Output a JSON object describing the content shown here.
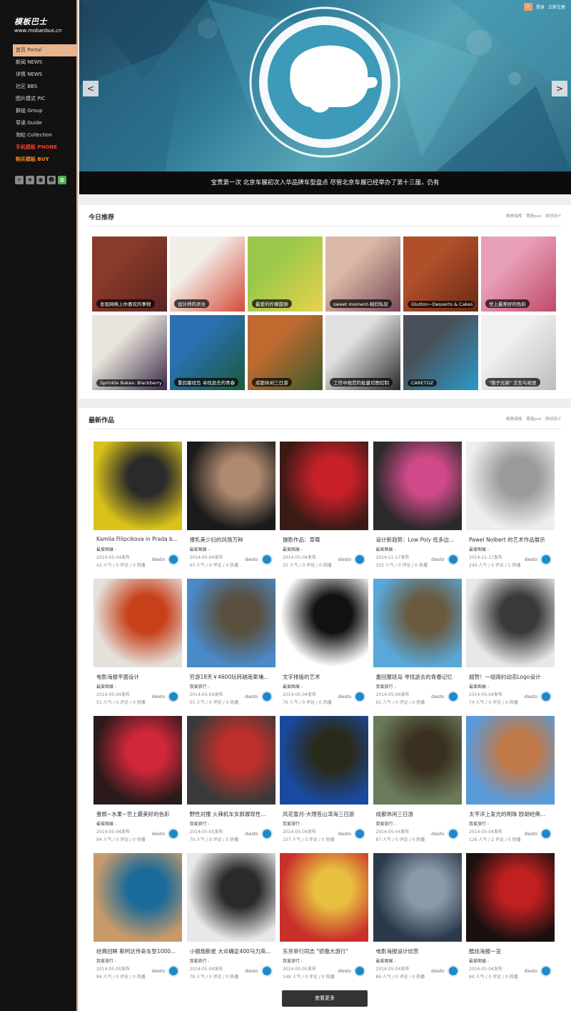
{
  "sidebar": {
    "logo_main": "模板巴士",
    "logo_sub": "www.mobanbus.cn",
    "nav": [
      {
        "label": "首页 Portal",
        "active": true
      },
      {
        "label": "新闻 NEWS"
      },
      {
        "label": "详情 NEWS"
      },
      {
        "label": "社区 BBS"
      },
      {
        "label": "图片模式 PIC"
      },
      {
        "label": "群组 Group"
      },
      {
        "label": "导读 Guide"
      },
      {
        "label": "淘帖 Collection"
      },
      {
        "label": "手机模板 PHONE",
        "style": "red"
      },
      {
        "label": "购买模板 BUY",
        "style": "orange"
      }
    ],
    "social_icons": [
      "plus-icon",
      "star-icon",
      "weibo-icon",
      "qq-icon",
      "wechat-icon"
    ]
  },
  "header": {
    "login": "登录",
    "register": "立即注册"
  },
  "banner": {
    "caption": "宝贵第一次 北京车展初次入华品牌车型盘点 尽管北京车展已经举办了第十三届，仍有",
    "prev": "<",
    "next": ">"
  },
  "recommend": {
    "title": "今日推荐",
    "links": [
      "精美海报",
      "筒造psd",
      "原创设计"
    ],
    "tiles": [
      {
        "label": "发现网络上你喜欢的事物",
        "colors": [
          "#8a3a2a",
          "#5a2420"
        ]
      },
      {
        "label": "设计师的灵光",
        "colors": [
          "#f2efe8",
          "#d54a3a"
        ]
      },
      {
        "label": "最爱的柠檬甜饼",
        "colors": [
          "#9bc84a",
          "#e8d24a"
        ]
      },
      {
        "label": "sweet moment-婉欣私房",
        "colors": [
          "#d9b9a6",
          "#7a4a5a"
        ]
      },
      {
        "label": "Glutton~Desserts & Cakes",
        "colors": [
          "#b0502a",
          "#6a2a16"
        ]
      },
      {
        "label": "世上最美好的色彩",
        "colors": [
          "#e8a0b8",
          "#c04a6a"
        ]
      },
      {
        "label": "Sprinkle Bakes: Blackberry",
        "colors": [
          "#e9e4dc",
          "#3a2a4a"
        ]
      },
      {
        "label": "重回塞班岛 寻找逝去的青春",
        "colors": [
          "#2a70b0",
          "#1a5a3a"
        ]
      },
      {
        "label": "成都休闲三日游",
        "colors": [
          "#c06a30",
          "#3a5a2a"
        ]
      },
      {
        "label": "工作中规范的批量切图控制",
        "colors": [
          "#e0e0e0",
          "#2a2a2a"
        ]
      },
      {
        "label": "CARETOZ",
        "colors": [
          "#4a505a",
          "#2a9ac8"
        ]
      },
      {
        "label": "\"筷子兄弟\" 交互与视觉",
        "colors": [
          "#f0f0f0",
          "#bcbcbc"
        ]
      }
    ]
  },
  "latest": {
    "title": "最新作品",
    "links": [
      "精美海报",
      "筒造psd",
      "原创设计"
    ],
    "cards": [
      {
        "title": "Kamila Filipcikova in Prada b...",
        "category": "最爱图展 -",
        "date": "2014-05-04发布",
        "stats": "42 人气 / 0 评论 / 0 热播",
        "author": "diesto",
        "colors": [
          "#d8c21a",
          "#2a2a2a"
        ]
      },
      {
        "title": "爆乳美少妇的风情万种",
        "category": "最爱图展 -",
        "date": "2014-05-04发布",
        "stats": "45 人气 / 0 评论 / 0 热播",
        "author": "diesto",
        "colors": [
          "#1a1a1a",
          "#b08a70"
        ]
      },
      {
        "title": "摄影作品：草莓",
        "category": "最爱图展 -",
        "date": "2014-05-04发布",
        "stats": "35 人气 / 0 评论 / 0 热播",
        "author": "diesto",
        "colors": [
          "#3a1a14",
          "#c8202a"
        ]
      },
      {
        "title": "设计新趋势：Low Poly 低多边...",
        "category": "最爱图展 -",
        "date": "2014-11-17发布",
        "stats": "323 人气 / 0 评论 / 0 热播",
        "author": "diesto",
        "colors": [
          "#2a2a2a",
          "#d04a8a"
        ]
      },
      {
        "title": "Pawel Nolbert 的艺术作品展示",
        "category": "最爱图展 -",
        "date": "2014-11-17发布",
        "stats": "244 人气 / 0 评论 / 1 热播",
        "author": "diesto",
        "colors": [
          "#eeeeee",
          "#9a9a9a"
        ]
      },
      {
        "title": "电影海报平面设计",
        "category": "最爱图展 -",
        "date": "2014-05-04发布",
        "stats": "51 人气 / 0 评论 / 0 热播",
        "author": "diesto",
        "colors": [
          "#e4e0da",
          "#c8401a"
        ]
      },
      {
        "title": "穷游18天￥4600玩转越南柬埔...",
        "category": "我爱旅行 -",
        "date": "2014-05-04发布",
        "stats": "55 人气 / 0 评论 / 0 热播",
        "author": "diesto",
        "colors": [
          "#4a8ac8",
          "#5a5040"
        ]
      },
      {
        "title": "文字排版的艺术",
        "category": "最爱图展 -",
        "date": "2014-05-04发布",
        "stats": "76 人气 / 0 评论 / 0 热播",
        "author": "diesto",
        "colors": [
          "#ffffff",
          "#111111"
        ]
      },
      {
        "title": "重回塞班岛 寻找逝去的青春记忆",
        "category": "我爱旅行 -",
        "date": "2014-05-04发布",
        "stats": "91 人气 / 0 评论 / 0 热播",
        "author": "diesto",
        "colors": [
          "#5aa8d8",
          "#6a5a40"
        ]
      },
      {
        "title": "超赞！一组简约动态Logo设计",
        "category": "最爱图展 -",
        "date": "2014-05-04发布",
        "stats": "74 人气 / 0 评论 / 0 热播",
        "author": "diesto",
        "colors": [
          "#e8e8e8",
          "#3a3a3a"
        ]
      },
      {
        "title": "蛋糕~水果~世上最美好的色彩",
        "category": "最爱图展 -",
        "date": "2014-05-04发布",
        "stats": "84 人气 / 0 评论 / 0 热播",
        "author": "diesto",
        "colors": [
          "#2a1a1a",
          "#d0283a"
        ]
      },
      {
        "title": "野性对撞 火辣机车女郎展现性...",
        "category": "我爱旅行 -",
        "date": "2014-05-05发布",
        "stats": "79 人气 / 0 评论 / 0 热播",
        "author": "diesto",
        "colors": [
          "#3a3a3a",
          "#c0302a"
        ]
      },
      {
        "title": "风花雪月-大理苍山洱海三日游",
        "category": "我爱旅行 -",
        "date": "2014-05-04发布",
        "stats": "107 人气 / 0 评论 / 0 热播",
        "author": "diesto",
        "colors": [
          "#1a4aa0",
          "#2a2a1a"
        ]
      },
      {
        "title": "成都休闲三日游",
        "category": "我爱旅行 -",
        "date": "2014-05-04发布",
        "stats": "87 人气 / 0 评论 / 0 热播",
        "author": "diesto",
        "colors": [
          "#6a7a5a",
          "#3a3020"
        ]
      },
      {
        "title": "太平洋上发光的明珠 欧胡经典...",
        "category": "我爱旅行 -",
        "date": "2014-05-04发布",
        "stats": "126 人气 / 2 评论 / 0 热播",
        "author": "diesto",
        "colors": [
          "#5a9ad8",
          "#c07a4a"
        ]
      },
      {
        "title": "经典回眸 斯柯达传奇车型1000...",
        "category": "我爱旅行 -",
        "date": "2014-05-05发布",
        "stats": "84 人气 / 0 评论 / 0 热播",
        "author": "diesto",
        "colors": [
          "#c89a6a",
          "#1a6a9a"
        ]
      },
      {
        "title": "小钢炮新星 大众确定400马力高...",
        "category": "我爱旅行 -",
        "date": "2014-05-04发布",
        "stats": "78 人气 / 0 评论 / 0 热播",
        "author": "diesto",
        "colors": [
          "#e8e8e8",
          "#2a2a2a"
        ]
      },
      {
        "title": "东京举行同志 \"骄傲大游行\"",
        "category": "我爱旅行 -",
        "date": "2014-05-05发布",
        "stats": "148 人气 / 0 评论 / 0 热播",
        "author": "diesto",
        "colors": [
          "#c8302a",
          "#e8c040"
        ]
      },
      {
        "title": "电影海报设计欣赏",
        "category": "最爱图展 -",
        "date": "2014-05-04发布",
        "stats": "86 人气 / 0 评论 / 0 热播",
        "author": "diesto",
        "colors": [
          "#2a3a4a",
          "#8a9aa8"
        ]
      },
      {
        "title": "酷炫海报一览",
        "category": "最爱图展 -",
        "date": "2014-05-04发布",
        "stats": "84 人气 / 0 评论 / 0 热播",
        "author": "diesto",
        "colors": [
          "#1a1010",
          "#c02020"
        ]
      }
    ],
    "more_button": "查看更多"
  }
}
